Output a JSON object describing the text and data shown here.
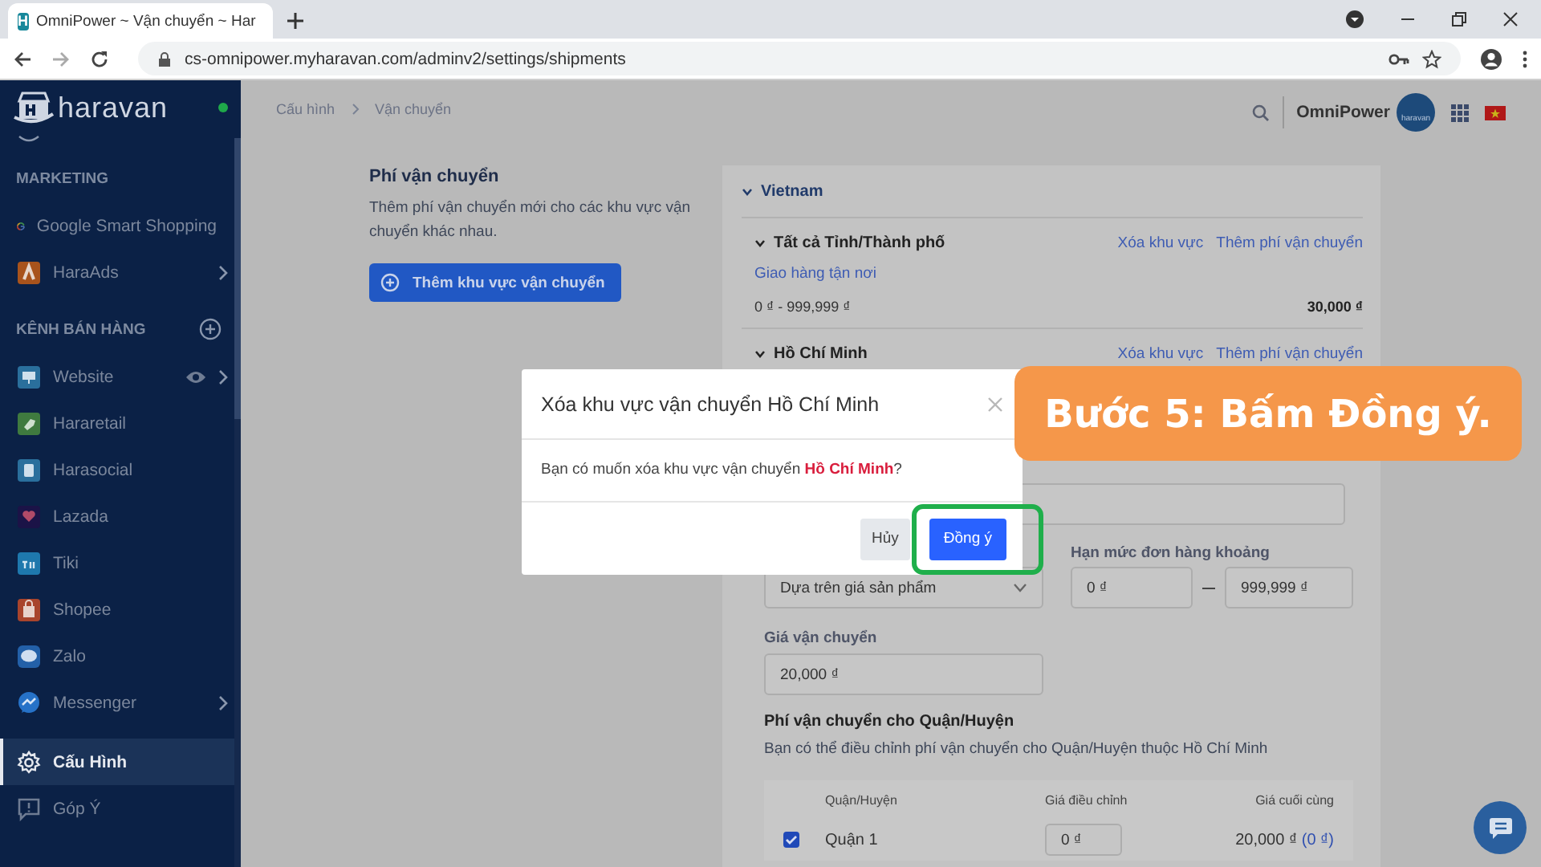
{
  "browser": {
    "favicon": "H",
    "tab_title": "OmniPower ~ Vận chuyển ~ Har",
    "url": "cs-omnipower.myharavan.com/adminv2/settings/shipments"
  },
  "sidebar": {
    "logo": "haravan",
    "online": true,
    "sections": [
      {
        "heading": "MARKETING",
        "can_add": false,
        "items": [
          {
            "label": "Google Smart Shopping",
            "selected": false,
            "has_submenu": false,
            "previewable": false
          },
          {
            "label": "HaraAds",
            "selected": false,
            "has_submenu": true,
            "previewable": false
          }
        ]
      },
      {
        "heading": "KÊNH BÁN HÀNG",
        "can_add": true,
        "items": [
          {
            "label": "Website",
            "selected": false,
            "has_submenu": true,
            "previewable": true
          },
          {
            "label": "Hararetail",
            "selected": false,
            "has_submenu": false,
            "previewable": false
          },
          {
            "label": "Harasocial",
            "selected": false,
            "has_submenu": false,
            "previewable": false
          },
          {
            "label": "Lazada",
            "selected": false,
            "has_submenu": false,
            "previewable": false
          },
          {
            "label": "Tiki",
            "selected": false,
            "has_submenu": false,
            "previewable": false
          },
          {
            "label": "Shopee",
            "selected": false,
            "has_submenu": false,
            "previewable": false
          },
          {
            "label": "Zalo",
            "selected": false,
            "has_submenu": false,
            "previewable": false
          },
          {
            "label": "Messenger",
            "selected": false,
            "has_submenu": true,
            "previewable": false
          }
        ]
      }
    ],
    "bottom_items": [
      {
        "label": "Cấu Hình",
        "selected": true
      },
      {
        "label": "Góp Ý",
        "selected": false
      }
    ]
  },
  "header": {
    "breadcrumb": [
      "Cấu hình",
      "Vận chuyển"
    ],
    "store_name": "OmniPower",
    "avatar_label": "haravan"
  },
  "intro": {
    "title": "Phí vận chuyển",
    "description": "Thêm phí vận chuyển mới cho các khu vực vận chuyển khác nhau.",
    "button": "Thêm khu vực vận chuyển"
  },
  "shipping": {
    "country": "Vietnam",
    "zones": [
      {
        "name": "Tất cả Tỉnh/Thành phố",
        "actions": [
          "Xóa khu vực",
          "Thêm phí vận chuyển"
        ],
        "rates": [
          {
            "name": "Giao hàng tận nơi",
            "range": "0 ₫ - 999,999 ₫",
            "price": "30,000 ₫"
          }
        ]
      },
      {
        "name": "Hồ Chí Minh",
        "actions": [
          "Xóa khu vực",
          "Thêm phí vận chuyển"
        ]
      }
    ],
    "form": {
      "condition": "Dựa trên giá sản phẩm",
      "range_label": "Hạn mức đơn hàng khoảng",
      "range_min": "0 ₫",
      "range_max": "999,999 ₫",
      "price_label": "Giá vận chuyển",
      "price": "20,000 ₫",
      "district_title": "Phí vận chuyển cho Quận/Huyện",
      "district_description": "Bạn có thể điều chỉnh phí vận chuyển cho Quận/Huyện thuộc Hồ Chí Minh",
      "columns": [
        "Quận/Huyện",
        "Giá điều chỉnh",
        "Giá cuối cùng"
      ],
      "rows": [
        {
          "checked": true,
          "district": "Quận 1",
          "adjustment": "0 ₫",
          "final": "20,000 ₫",
          "difference": "(0 ₫)"
        }
      ]
    }
  },
  "dialog": {
    "title": "Xóa khu vực vận chuyển Hồ Chí Minh",
    "message": "Bạn có muốn xóa khu vực vận chuyển **Hồ Chí Minh**?",
    "buttons": [
      {
        "label": "Hủy",
        "kind": "secondary",
        "highlighted": false
      },
      {
        "label": "Đồng ý",
        "kind": "primary",
        "highlighted": true
      }
    ]
  },
  "callout": {
    "text": "Bước 5: Bấm Đồng ý."
  }
}
